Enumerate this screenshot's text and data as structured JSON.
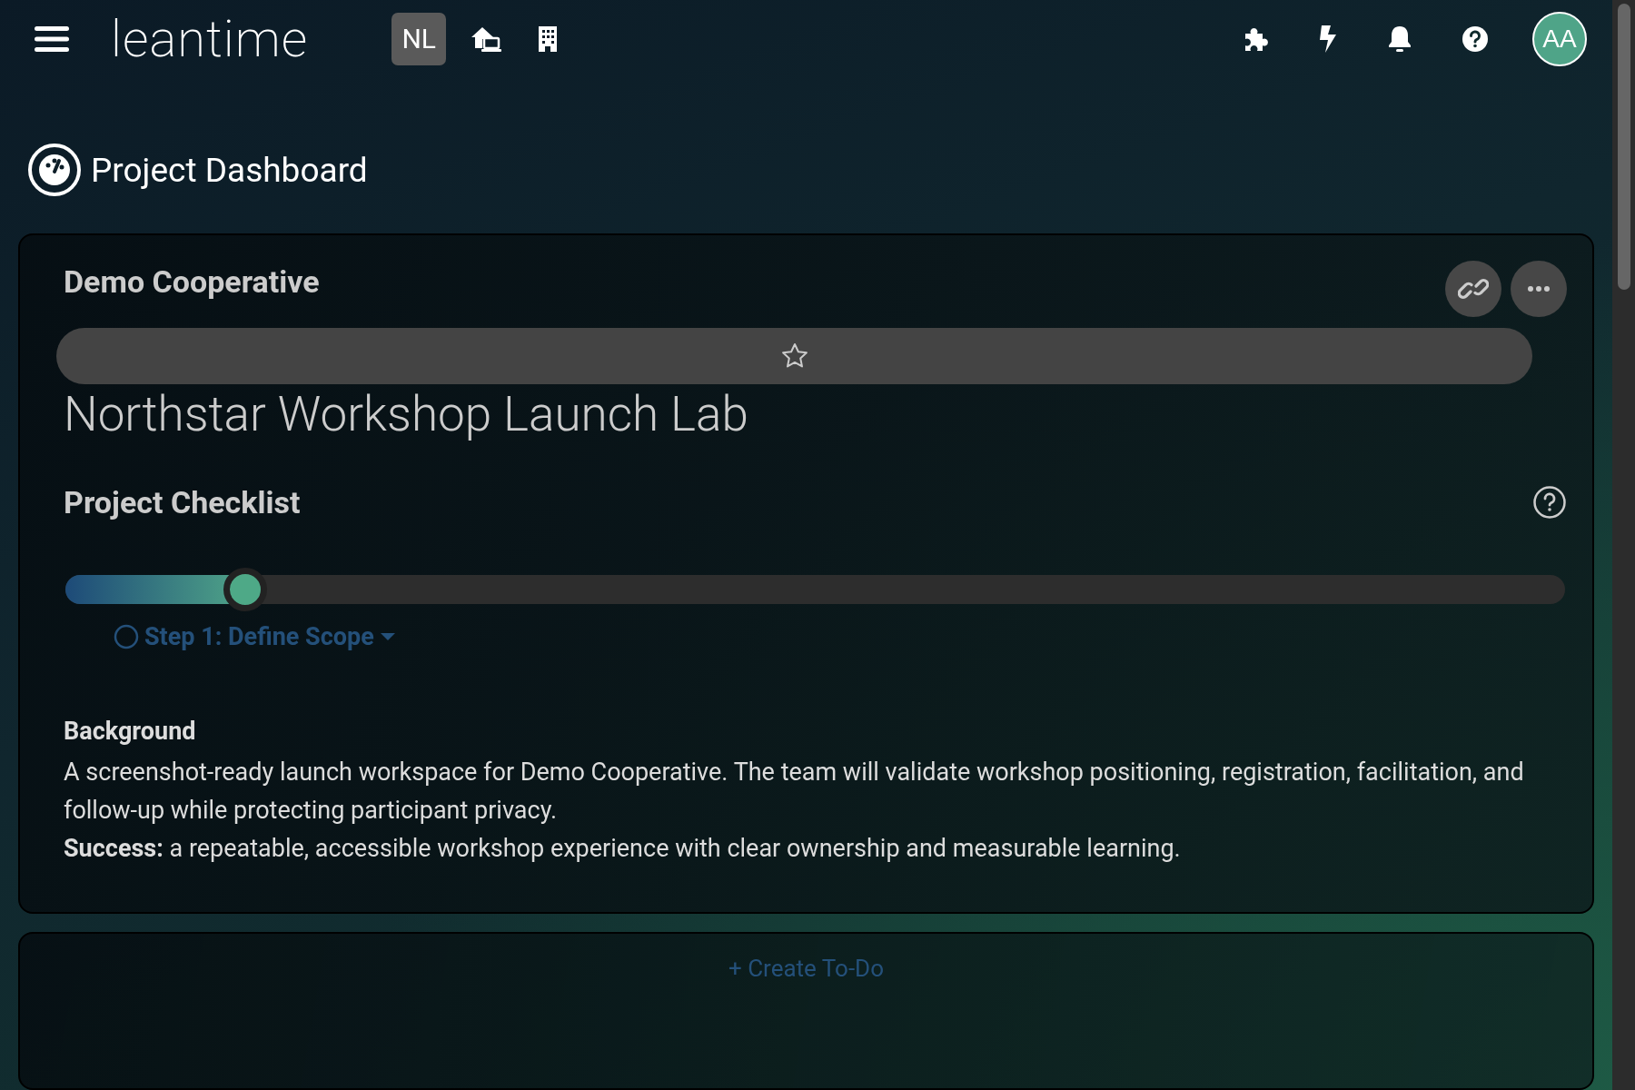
{
  "header": {
    "logo": "leantime",
    "project_badge": "NL",
    "avatar": "AA"
  },
  "page_title": "Project Dashboard",
  "project_card": {
    "client": "Demo Cooperative",
    "favorite": false,
    "name": "Northstar Workshop Launch Lab"
  },
  "checklist": {
    "title": "Project Checklist",
    "level": 0.12,
    "steps": [
      {
        "label": "Step 1: Define Scope",
        "completed": false
      }
    ]
  },
  "background": {
    "heading": "Background",
    "text": "A screenshot-ready launch workspace for Demo Cooperative. The team will validate workshop positioning, registration, facilitation, and follow-up while protecting participant privacy.",
    "success": "**Success:** a repeatable, accessible workshop experience with clear ownership and measurable learning."
  },
  "todo_card": {
    "action": "+ Create To-Do"
  }
}
